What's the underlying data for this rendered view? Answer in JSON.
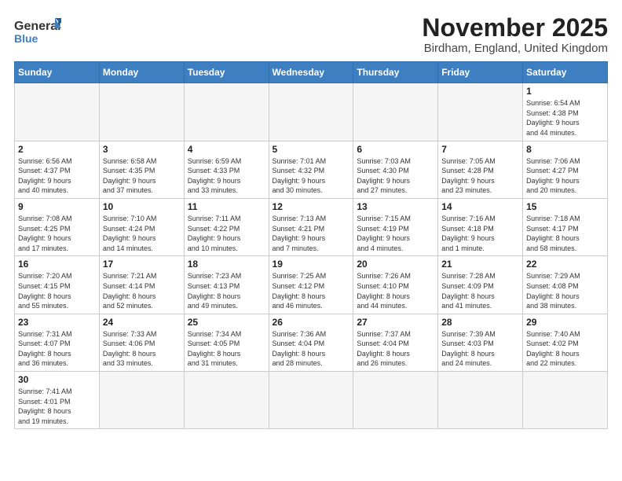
{
  "header": {
    "logo_general": "General",
    "logo_blue": "Blue",
    "title": "November 2025",
    "subtitle": "Birdham, England, United Kingdom"
  },
  "weekdays": [
    "Sunday",
    "Monday",
    "Tuesday",
    "Wednesday",
    "Thursday",
    "Friday",
    "Saturday"
  ],
  "days": [
    {
      "num": "",
      "info": "",
      "empty": true
    },
    {
      "num": "",
      "info": "",
      "empty": true
    },
    {
      "num": "",
      "info": "",
      "empty": true
    },
    {
      "num": "",
      "info": "",
      "empty": true
    },
    {
      "num": "",
      "info": "",
      "empty": true
    },
    {
      "num": "",
      "info": "",
      "empty": true
    },
    {
      "num": "1",
      "info": "Sunrise: 6:54 AM\nSunset: 4:38 PM\nDaylight: 9 hours\nand 44 minutes.",
      "empty": false
    },
    {
      "num": "2",
      "info": "Sunrise: 6:56 AM\nSunset: 4:37 PM\nDaylight: 9 hours\nand 40 minutes.",
      "empty": false
    },
    {
      "num": "3",
      "info": "Sunrise: 6:58 AM\nSunset: 4:35 PM\nDaylight: 9 hours\nand 37 minutes.",
      "empty": false
    },
    {
      "num": "4",
      "info": "Sunrise: 6:59 AM\nSunset: 4:33 PM\nDaylight: 9 hours\nand 33 minutes.",
      "empty": false
    },
    {
      "num": "5",
      "info": "Sunrise: 7:01 AM\nSunset: 4:32 PM\nDaylight: 9 hours\nand 30 minutes.",
      "empty": false
    },
    {
      "num": "6",
      "info": "Sunrise: 7:03 AM\nSunset: 4:30 PM\nDaylight: 9 hours\nand 27 minutes.",
      "empty": false
    },
    {
      "num": "7",
      "info": "Sunrise: 7:05 AM\nSunset: 4:28 PM\nDaylight: 9 hours\nand 23 minutes.",
      "empty": false
    },
    {
      "num": "8",
      "info": "Sunrise: 7:06 AM\nSunset: 4:27 PM\nDaylight: 9 hours\nand 20 minutes.",
      "empty": false
    },
    {
      "num": "9",
      "info": "Sunrise: 7:08 AM\nSunset: 4:25 PM\nDaylight: 9 hours\nand 17 minutes.",
      "empty": false
    },
    {
      "num": "10",
      "info": "Sunrise: 7:10 AM\nSunset: 4:24 PM\nDaylight: 9 hours\nand 14 minutes.",
      "empty": false
    },
    {
      "num": "11",
      "info": "Sunrise: 7:11 AM\nSunset: 4:22 PM\nDaylight: 9 hours\nand 10 minutes.",
      "empty": false
    },
    {
      "num": "12",
      "info": "Sunrise: 7:13 AM\nSunset: 4:21 PM\nDaylight: 9 hours\nand 7 minutes.",
      "empty": false
    },
    {
      "num": "13",
      "info": "Sunrise: 7:15 AM\nSunset: 4:19 PM\nDaylight: 9 hours\nand 4 minutes.",
      "empty": false
    },
    {
      "num": "14",
      "info": "Sunrise: 7:16 AM\nSunset: 4:18 PM\nDaylight: 9 hours\nand 1 minute.",
      "empty": false
    },
    {
      "num": "15",
      "info": "Sunrise: 7:18 AM\nSunset: 4:17 PM\nDaylight: 8 hours\nand 58 minutes.",
      "empty": false
    },
    {
      "num": "16",
      "info": "Sunrise: 7:20 AM\nSunset: 4:15 PM\nDaylight: 8 hours\nand 55 minutes.",
      "empty": false
    },
    {
      "num": "17",
      "info": "Sunrise: 7:21 AM\nSunset: 4:14 PM\nDaylight: 8 hours\nand 52 minutes.",
      "empty": false
    },
    {
      "num": "18",
      "info": "Sunrise: 7:23 AM\nSunset: 4:13 PM\nDaylight: 8 hours\nand 49 minutes.",
      "empty": false
    },
    {
      "num": "19",
      "info": "Sunrise: 7:25 AM\nSunset: 4:12 PM\nDaylight: 8 hours\nand 46 minutes.",
      "empty": false
    },
    {
      "num": "20",
      "info": "Sunrise: 7:26 AM\nSunset: 4:10 PM\nDaylight: 8 hours\nand 44 minutes.",
      "empty": false
    },
    {
      "num": "21",
      "info": "Sunrise: 7:28 AM\nSunset: 4:09 PM\nDaylight: 8 hours\nand 41 minutes.",
      "empty": false
    },
    {
      "num": "22",
      "info": "Sunrise: 7:29 AM\nSunset: 4:08 PM\nDaylight: 8 hours\nand 38 minutes.",
      "empty": false
    },
    {
      "num": "23",
      "info": "Sunrise: 7:31 AM\nSunset: 4:07 PM\nDaylight: 8 hours\nand 36 minutes.",
      "empty": false
    },
    {
      "num": "24",
      "info": "Sunrise: 7:33 AM\nSunset: 4:06 PM\nDaylight: 8 hours\nand 33 minutes.",
      "empty": false
    },
    {
      "num": "25",
      "info": "Sunrise: 7:34 AM\nSunset: 4:05 PM\nDaylight: 8 hours\nand 31 minutes.",
      "empty": false
    },
    {
      "num": "26",
      "info": "Sunrise: 7:36 AM\nSunset: 4:04 PM\nDaylight: 8 hours\nand 28 minutes.",
      "empty": false
    },
    {
      "num": "27",
      "info": "Sunrise: 7:37 AM\nSunset: 4:04 PM\nDaylight: 8 hours\nand 26 minutes.",
      "empty": false
    },
    {
      "num": "28",
      "info": "Sunrise: 7:39 AM\nSunset: 4:03 PM\nDaylight: 8 hours\nand 24 minutes.",
      "empty": false
    },
    {
      "num": "29",
      "info": "Sunrise: 7:40 AM\nSunset: 4:02 PM\nDaylight: 8 hours\nand 22 minutes.",
      "empty": false
    },
    {
      "num": "30",
      "info": "Sunrise: 7:41 AM\nSunset: 4:01 PM\nDaylight: 8 hours\nand 19 minutes.",
      "empty": false
    },
    {
      "num": "",
      "info": "",
      "empty": true
    },
    {
      "num": "",
      "info": "",
      "empty": true
    },
    {
      "num": "",
      "info": "",
      "empty": true
    },
    {
      "num": "",
      "info": "",
      "empty": true
    },
    {
      "num": "",
      "info": "",
      "empty": true
    },
    {
      "num": "",
      "info": "",
      "empty": true
    }
  ]
}
